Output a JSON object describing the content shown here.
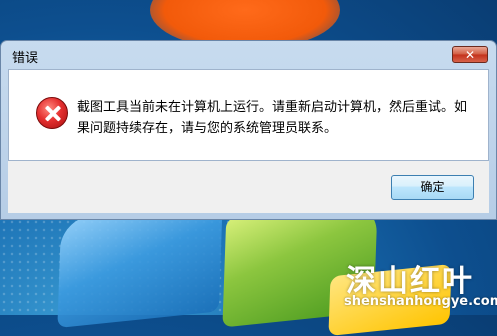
{
  "dialog": {
    "title": "错误",
    "close_label": "✕",
    "icon": "error-icon",
    "message": "截图工具当前未在计算机上运行。请重新启动计算机，然后重试。如果问题持续存在，请与您的系统管理员联系。",
    "ok_label": "确定"
  },
  "watermark": {
    "logo_text": "深山红叶",
    "url": "shenshanhongye.com"
  },
  "colors": {
    "close_button": "#c3301a",
    "error_icon": "#e53030",
    "ok_button_border": "#3c7fb1"
  }
}
